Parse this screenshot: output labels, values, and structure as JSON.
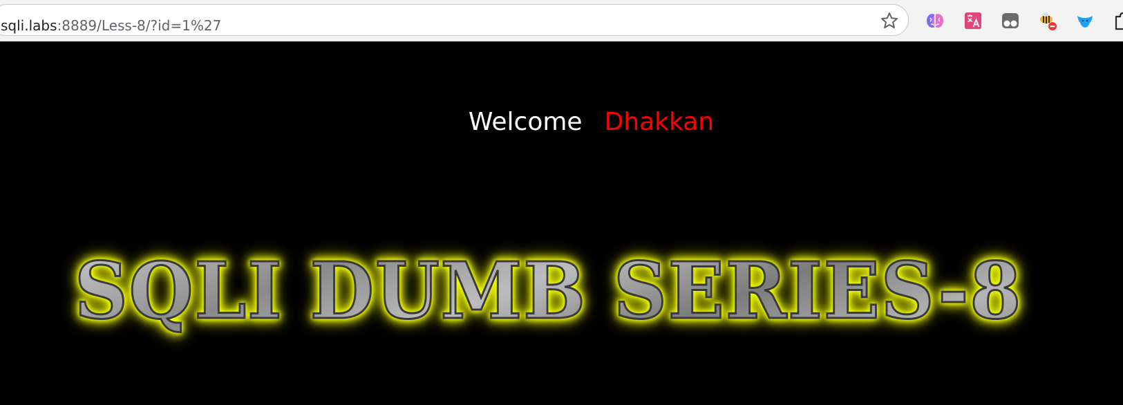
{
  "browser": {
    "address_bar": {
      "host": "sqli.labs",
      "path": ":8889/Less-8/?id=1%27"
    },
    "toolbar_icons": [
      "bookmark-star-icon",
      "brain-extension-icon",
      "translate-extension-icon",
      "tampermonkey-extension-icon",
      "bee-extension-icon",
      "bird-extension-icon",
      "puzzle-extensions-icon"
    ],
    "colors": {
      "translate_ext": "#e2457a",
      "bird_ext": "#1da1f2",
      "blocked_badge": "#e53935"
    }
  },
  "page": {
    "welcome_label": "Welcome",
    "user_name": "Dhakkan",
    "banner_title": "SQLI DUMB SERIES-8",
    "colors": {
      "background": "#000000",
      "welcome": "#ffffff",
      "name": "#ff0000",
      "banner_glow": "#ffff00"
    }
  }
}
